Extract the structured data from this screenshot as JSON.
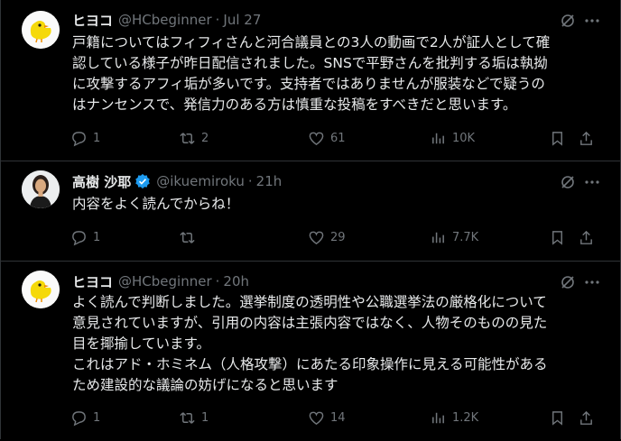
{
  "posts": [
    {
      "author": "ヒヨコ",
      "handle": "@HCbeginner",
      "dot": "·",
      "time": "Jul 27",
      "text_lines": [
        "戸籍についてはフィフィさんと河合議員との3人の動画で2人が証人として確",
        "認している様子が昨日配信されました。SNSで平野さんを批判する垢は執拗",
        "に攻撃するアフィ垢が多いです。支持者ではありませんが服装などで疑うの",
        "はナンセンスで、発信力のある方は慎重な投稿をすべきだと思います。"
      ],
      "replies": "1",
      "reposts": "2",
      "likes": "61",
      "views": "10K",
      "avatar_icon": "chick-icon"
    },
    {
      "author": "高樹 沙耶",
      "verified": true,
      "handle": "@ikuemiroku",
      "dot": "·",
      "time": "21h",
      "text_lines": [
        "内容をよく読んでからね！"
      ],
      "replies": "1",
      "reposts": "",
      "likes": "29",
      "views": "7.7K",
      "avatar_icon": "profile-photo"
    },
    {
      "author": "ヒヨコ",
      "handle": "@HCbeginner",
      "dot": "·",
      "time": "20h",
      "text_lines": [
        "よく読んで判断しました。選挙制度の透明性や公職選挙法の厳格化について",
        "意見されていますが、引用の内容は主張内容ではなく、人物そのものの見た",
        "目を揶揄しています。",
        "これはアド・ホミネム（人格攻撃）にあたる印象操作に見える可能性がある",
        "ため建設的な議論の妨げになると思います"
      ],
      "replies": "1",
      "reposts": "1",
      "likes": "14",
      "views": "1.2K",
      "avatar_icon": "chick-icon"
    }
  ],
  "colors": {
    "background": "#000000",
    "text": "#e7e9ea",
    "muted": "#71767b",
    "verified": "#1d9bf0",
    "border": "#2f3336",
    "chick_yellow": "#f5d90a"
  }
}
